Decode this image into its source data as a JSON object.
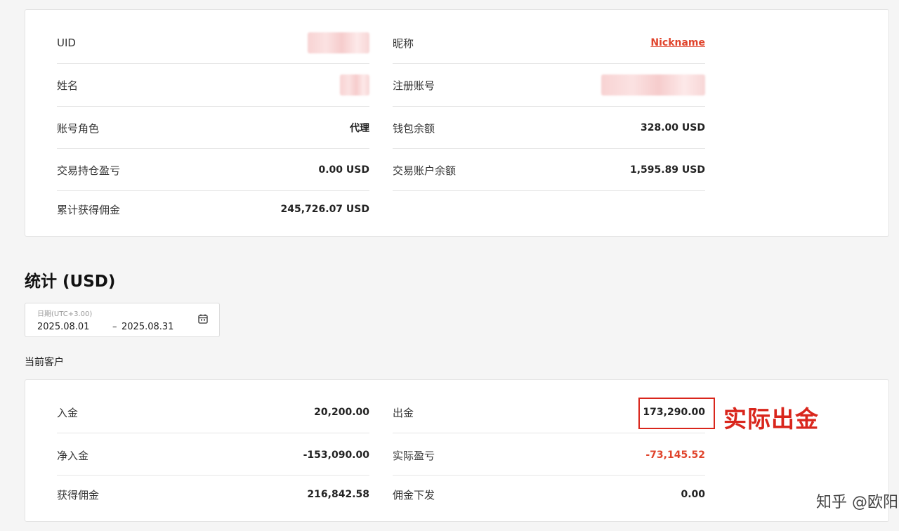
{
  "profile": {
    "uid_label": "UID",
    "nickname_label": "昵称",
    "nickname_value": "Nickname",
    "name_label": "姓名",
    "registered_account_label": "注册账号",
    "role_label": "账号角色",
    "role_value": "代理",
    "wallet_balance_label": "钱包余额",
    "wallet_balance_value": "328.00 USD",
    "position_pnl_label": "交易持仓盈亏",
    "position_pnl_value": "0.00 USD",
    "trading_balance_label": "交易账户余额",
    "trading_balance_value": "1,595.89 USD",
    "total_commission_label": "累计获得佣金",
    "total_commission_value": "245,726.07 USD"
  },
  "stats": {
    "title": "统计 (USD)",
    "date": {
      "label": "日期(UTC+3.00)",
      "start": "2025.08.01",
      "separator": "–",
      "end": "2025.08.31"
    },
    "subtitle": "当前客户",
    "deposit_label": "入金",
    "deposit_value": "20,200.00",
    "withdraw_label": "出金",
    "withdraw_value": "173,290.00",
    "net_deposit_label": "净入金",
    "net_deposit_value": "-153,090.00",
    "actual_pnl_label": "实际盈亏",
    "actual_pnl_value": "-73,145.52",
    "earned_commission_label": "获得佣金",
    "earned_commission_value": "216,842.58",
    "commission_paid_label": "佣金下发",
    "commission_paid_value": "0.00"
  },
  "annotation": {
    "text": "实际出金",
    "color": "#d9261c"
  },
  "watermark": "知乎 @欧阳",
  "colors": {
    "accent_red": "#e0442c"
  }
}
